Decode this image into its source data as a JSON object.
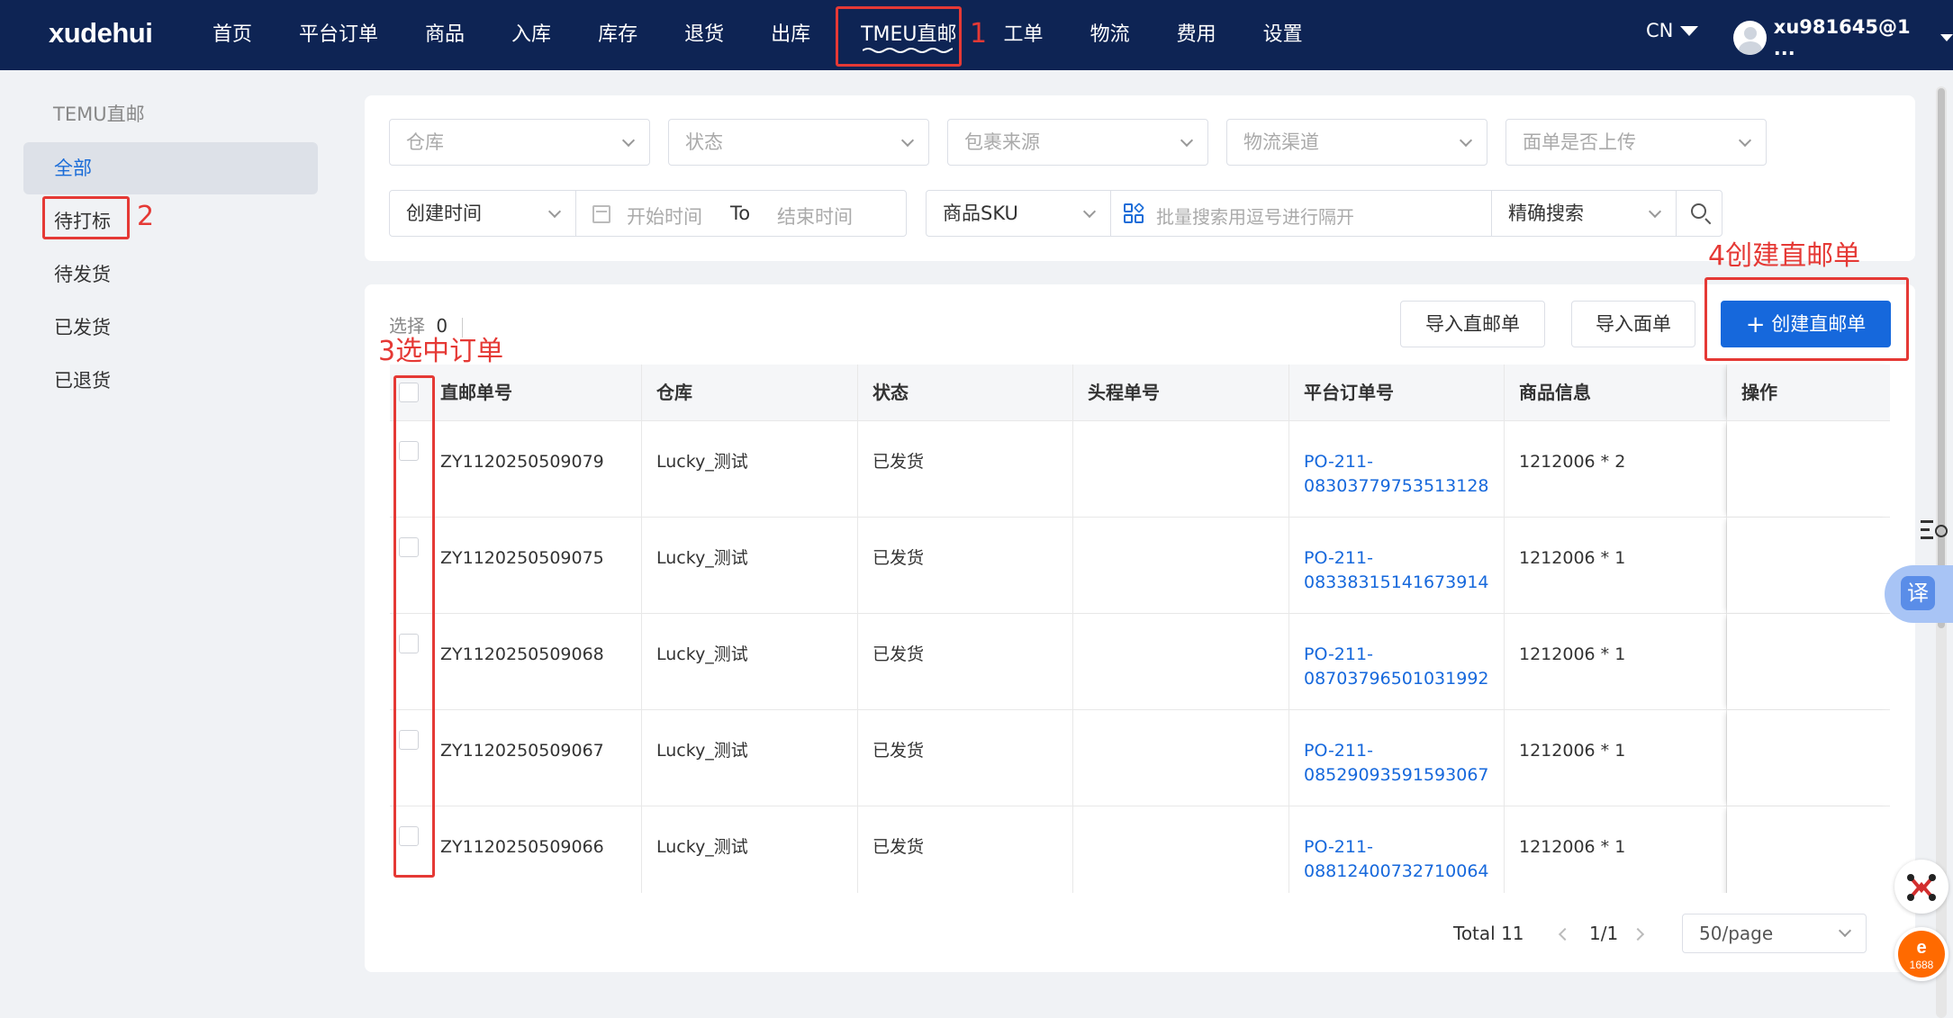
{
  "app": {
    "logo": "xudehui"
  },
  "nav": {
    "items": [
      "首页",
      "平台订单",
      "商品",
      "入库",
      "库存",
      "退货",
      "出库",
      "TMEU直邮",
      "工单",
      "物流",
      "费用",
      "设置"
    ],
    "active": "TMEU直邮"
  },
  "header": {
    "language": "CN",
    "user": "xu981645@1 ..."
  },
  "annotations": {
    "a1": "1",
    "a2": "2",
    "a3": "3选中订单",
    "a4": "4创建直邮单",
    "color": "#e53935"
  },
  "sidebar": {
    "title": "TEMU直邮",
    "items": [
      "全部",
      "待打标",
      "待发货",
      "已发货",
      "已退货"
    ],
    "active": "全部"
  },
  "filters": {
    "row1": [
      "仓库",
      "状态",
      "包裹来源",
      "物流渠道",
      "面单是否上传"
    ],
    "time_type": "创建时间",
    "start_placeholder": "开始时间",
    "to_label": "To",
    "end_placeholder": "结束时间",
    "sku_type": "商品SKU",
    "batch_placeholder": "批量搜索用逗号进行隔开",
    "match_mode": "精确搜索"
  },
  "toolbar": {
    "selected_label": "选择",
    "selected_count": "0",
    "import_direct": "导入直邮单",
    "import_label": "导入面单",
    "create_direct": "创建直邮单"
  },
  "table": {
    "headers": [
      "直邮单号",
      "仓库",
      "状态",
      "头程单号",
      "平台订单号",
      "商品信息",
      "操作"
    ],
    "rows": [
      {
        "id": "ZY1120250509079",
        "warehouse": "Lucky_测试",
        "status": "已发货",
        "first_leg": "",
        "order_a": "PO-211-",
        "order_b": "08303779753513128",
        "goods": "1212006 * 2"
      },
      {
        "id": "ZY1120250509075",
        "warehouse": "Lucky_测试",
        "status": "已发货",
        "first_leg": "",
        "order_a": "PO-211-",
        "order_b": "08338315141673914",
        "goods": "1212006 * 1"
      },
      {
        "id": "ZY1120250509068",
        "warehouse": "Lucky_测试",
        "status": "已发货",
        "first_leg": "",
        "order_a": "PO-211-",
        "order_b": "08703796501031992",
        "goods": "1212006 * 1"
      },
      {
        "id": "ZY1120250509067",
        "warehouse": "Lucky_测试",
        "status": "已发货",
        "first_leg": "",
        "order_a": "PO-211-",
        "order_b": "08529093591593067",
        "goods": "1212006 * 1"
      },
      {
        "id": "ZY1120250509066",
        "warehouse": "Lucky_测试",
        "status": "已发货",
        "first_leg": "",
        "order_a": "PO-211-",
        "order_b": "08812400732710064",
        "goods": "1212006 * 1"
      }
    ]
  },
  "pagination": {
    "total": "Total 11",
    "page": "1/1",
    "page_size": "50/page"
  },
  "floating": {
    "translate": "译"
  },
  "colors": {
    "nav_bg": "#0e2454",
    "primary": "#1668dc",
    "link": "#1668dc"
  }
}
